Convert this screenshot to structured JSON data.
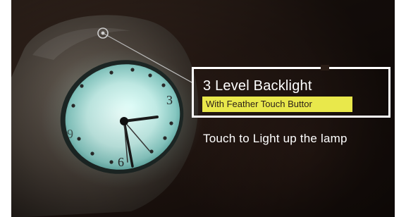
{
  "callout": {
    "title": "3 Level Backlight",
    "subtitle": "With Feather Touch Buttor",
    "highlight_color": "#e9e84b",
    "box_color": "#ffffff"
  },
  "caption": {
    "text": "Touch to Light up the lamp"
  },
  "clock": {
    "dial_numbers": [
      "3",
      "6",
      "9"
    ],
    "glow_color": "#bff3ee"
  },
  "icons": {
    "marker": "touch-point-marker-icon"
  }
}
